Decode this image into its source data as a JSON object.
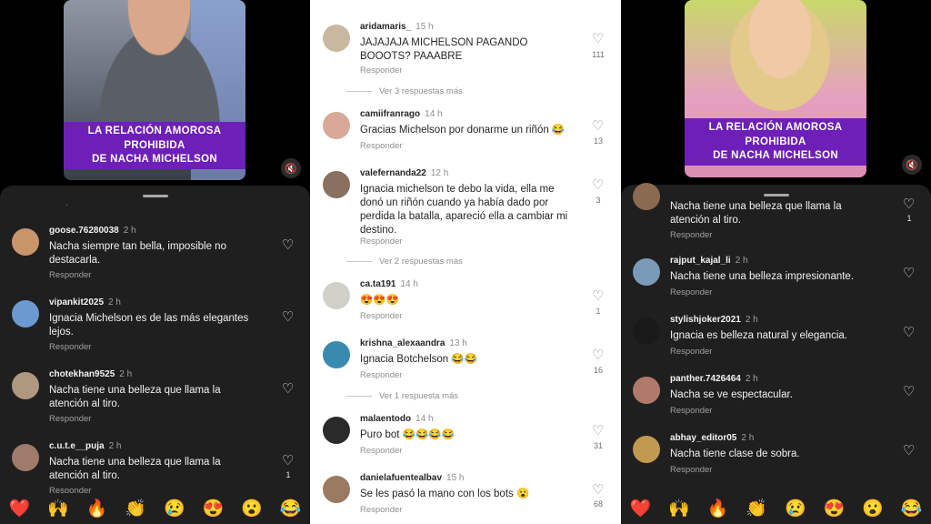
{
  "left": {
    "banner": [
      "LA RELACIÓN AMOROSA",
      "PROHIBIDA",
      "DE NACHA MICHELSON"
    ],
    "mute_icon": "speaker-muted-icon",
    "dot": ".",
    "comments": [
      {
        "user": "goose.76280038",
        "time": "2 h",
        "text": [
          "Nacha siempre tan bella, imposible no",
          "destacarla."
        ],
        "reply": "Responder",
        "likes": "",
        "avatar_color": "#c8956b"
      },
      {
        "user": "vipankit2025",
        "time": "2 h",
        "text": [
          "Ignacia Michelson es de las más elegantes",
          "lejos."
        ],
        "reply": "Responder",
        "likes": "",
        "avatar_color": "#6c9ad0"
      },
      {
        "user": "chotekhan9525",
        "time": "2 h",
        "text": [
          "Nacha tiene una belleza que llama la",
          "atención al tiro."
        ],
        "reply": "Responder",
        "likes": "",
        "avatar_color": "#b09880"
      },
      {
        "user": "c.u.t.e__puja",
        "time": "2 h",
        "text": [
          "Nacha tiene una belleza que llama la",
          "atención al tiro."
        ],
        "reply": "Responder",
        "likes": "1",
        "avatar_color": "#a07a6a"
      }
    ],
    "emojis": [
      "❤️",
      "🙌",
      "🔥",
      "👏",
      "😢",
      "😍",
      "😮",
      "😂"
    ]
  },
  "middle": {
    "comments": [
      {
        "user": "aridamaris_",
        "time": "15 h",
        "text": [
          "JAJAJAJA MICHELSON PAGANDO",
          "BOOOTS? PAAABRE"
        ],
        "reply": "Responder",
        "likes": "111",
        "avatar_color": "#c9b8a0"
      },
      {
        "user": "camiifranrago",
        "time": "14 h",
        "text": [
          "Gracias Michelson por donarme un riñón 😂"
        ],
        "reply": "Responder",
        "likes": "13",
        "avatar_color": "#d8a898"
      },
      {
        "user": "valefernanda22",
        "time": "12 h",
        "text": [
          "Ignacia michelson te debo la vida, ella me",
          "donó un riñón cuando ya había dado por",
          "perdida la batalla, apareció ella a cambiar mi",
          "destino."
        ],
        "reply": "Responder",
        "likes": "3",
        "avatar_color": "#8a7060"
      },
      {
        "user": "ca.ta191",
        "time": "14 h",
        "text": [
          "😍😍😍"
        ],
        "reply": "Responder",
        "likes": "1",
        "avatar_color": "#d0d0c8"
      },
      {
        "user": "krishna_alexaandra",
        "time": "13 h",
        "text": [
          "Ignacia Botchelson 😂😂"
        ],
        "reply": "Responder",
        "likes": "16",
        "avatar_color": "#3a8ab0"
      },
      {
        "user": "malaentodo",
        "time": "14 h",
        "text": [
          "Puro bot 😂😂😂😂"
        ],
        "reply": "Responder",
        "likes": "31",
        "avatar_color": "#2a2a2a"
      },
      {
        "user": "danielafuentealbav",
        "time": "15 h",
        "text": [
          "Se les pasó la mano con los bots 😮"
        ],
        "reply": "Responder",
        "likes": "68",
        "avatar_color": "#9a7a60"
      }
    ],
    "more_replies": [
      "Ver 3 respuestas más",
      "Ver 2 respuestas más",
      "Ver 1 respuesta más"
    ]
  },
  "right": {
    "banner": [
      "LA RELACIÓN AMOROSA",
      "PROHIBIDA",
      "DE NACHA MICHELSON"
    ],
    "mute_icon": "speaker-muted-icon",
    "partial_comment": {
      "text": [
        "Nacha tiene una belleza que llama la",
        "atención al tiro."
      ],
      "reply": "Responder",
      "likes": "1",
      "avatar_color": "#8a6a50"
    },
    "comments": [
      {
        "user": "rajput_kajal_li",
        "time": "2 h",
        "text": [
          "Nacha tiene una belleza impresionante."
        ],
        "reply": "Responder",
        "likes": "",
        "avatar_color": "#7a9ab8"
      },
      {
        "user": "stylishjoker2021",
        "time": "2 h",
        "text": [
          "Ignacia es belleza natural y elegancia."
        ],
        "reply": "Responder",
        "likes": "",
        "avatar_color": "#1a1a1a"
      },
      {
        "user": "panther.7426464",
        "time": "2 h",
        "text": [
          "Nacha se ve espectacular."
        ],
        "reply": "Responder",
        "likes": "",
        "avatar_color": "#b07a6a"
      },
      {
        "user": "abhay_editor05",
        "time": "2 h",
        "text": [
          "Nacha tiene clase de sobra."
        ],
        "reply": "Responder",
        "likes": "",
        "avatar_color": "#c09a50"
      }
    ],
    "emojis": [
      "❤️",
      "🙌",
      "🔥",
      "👏",
      "😢",
      "😍",
      "😮",
      "😂"
    ]
  }
}
